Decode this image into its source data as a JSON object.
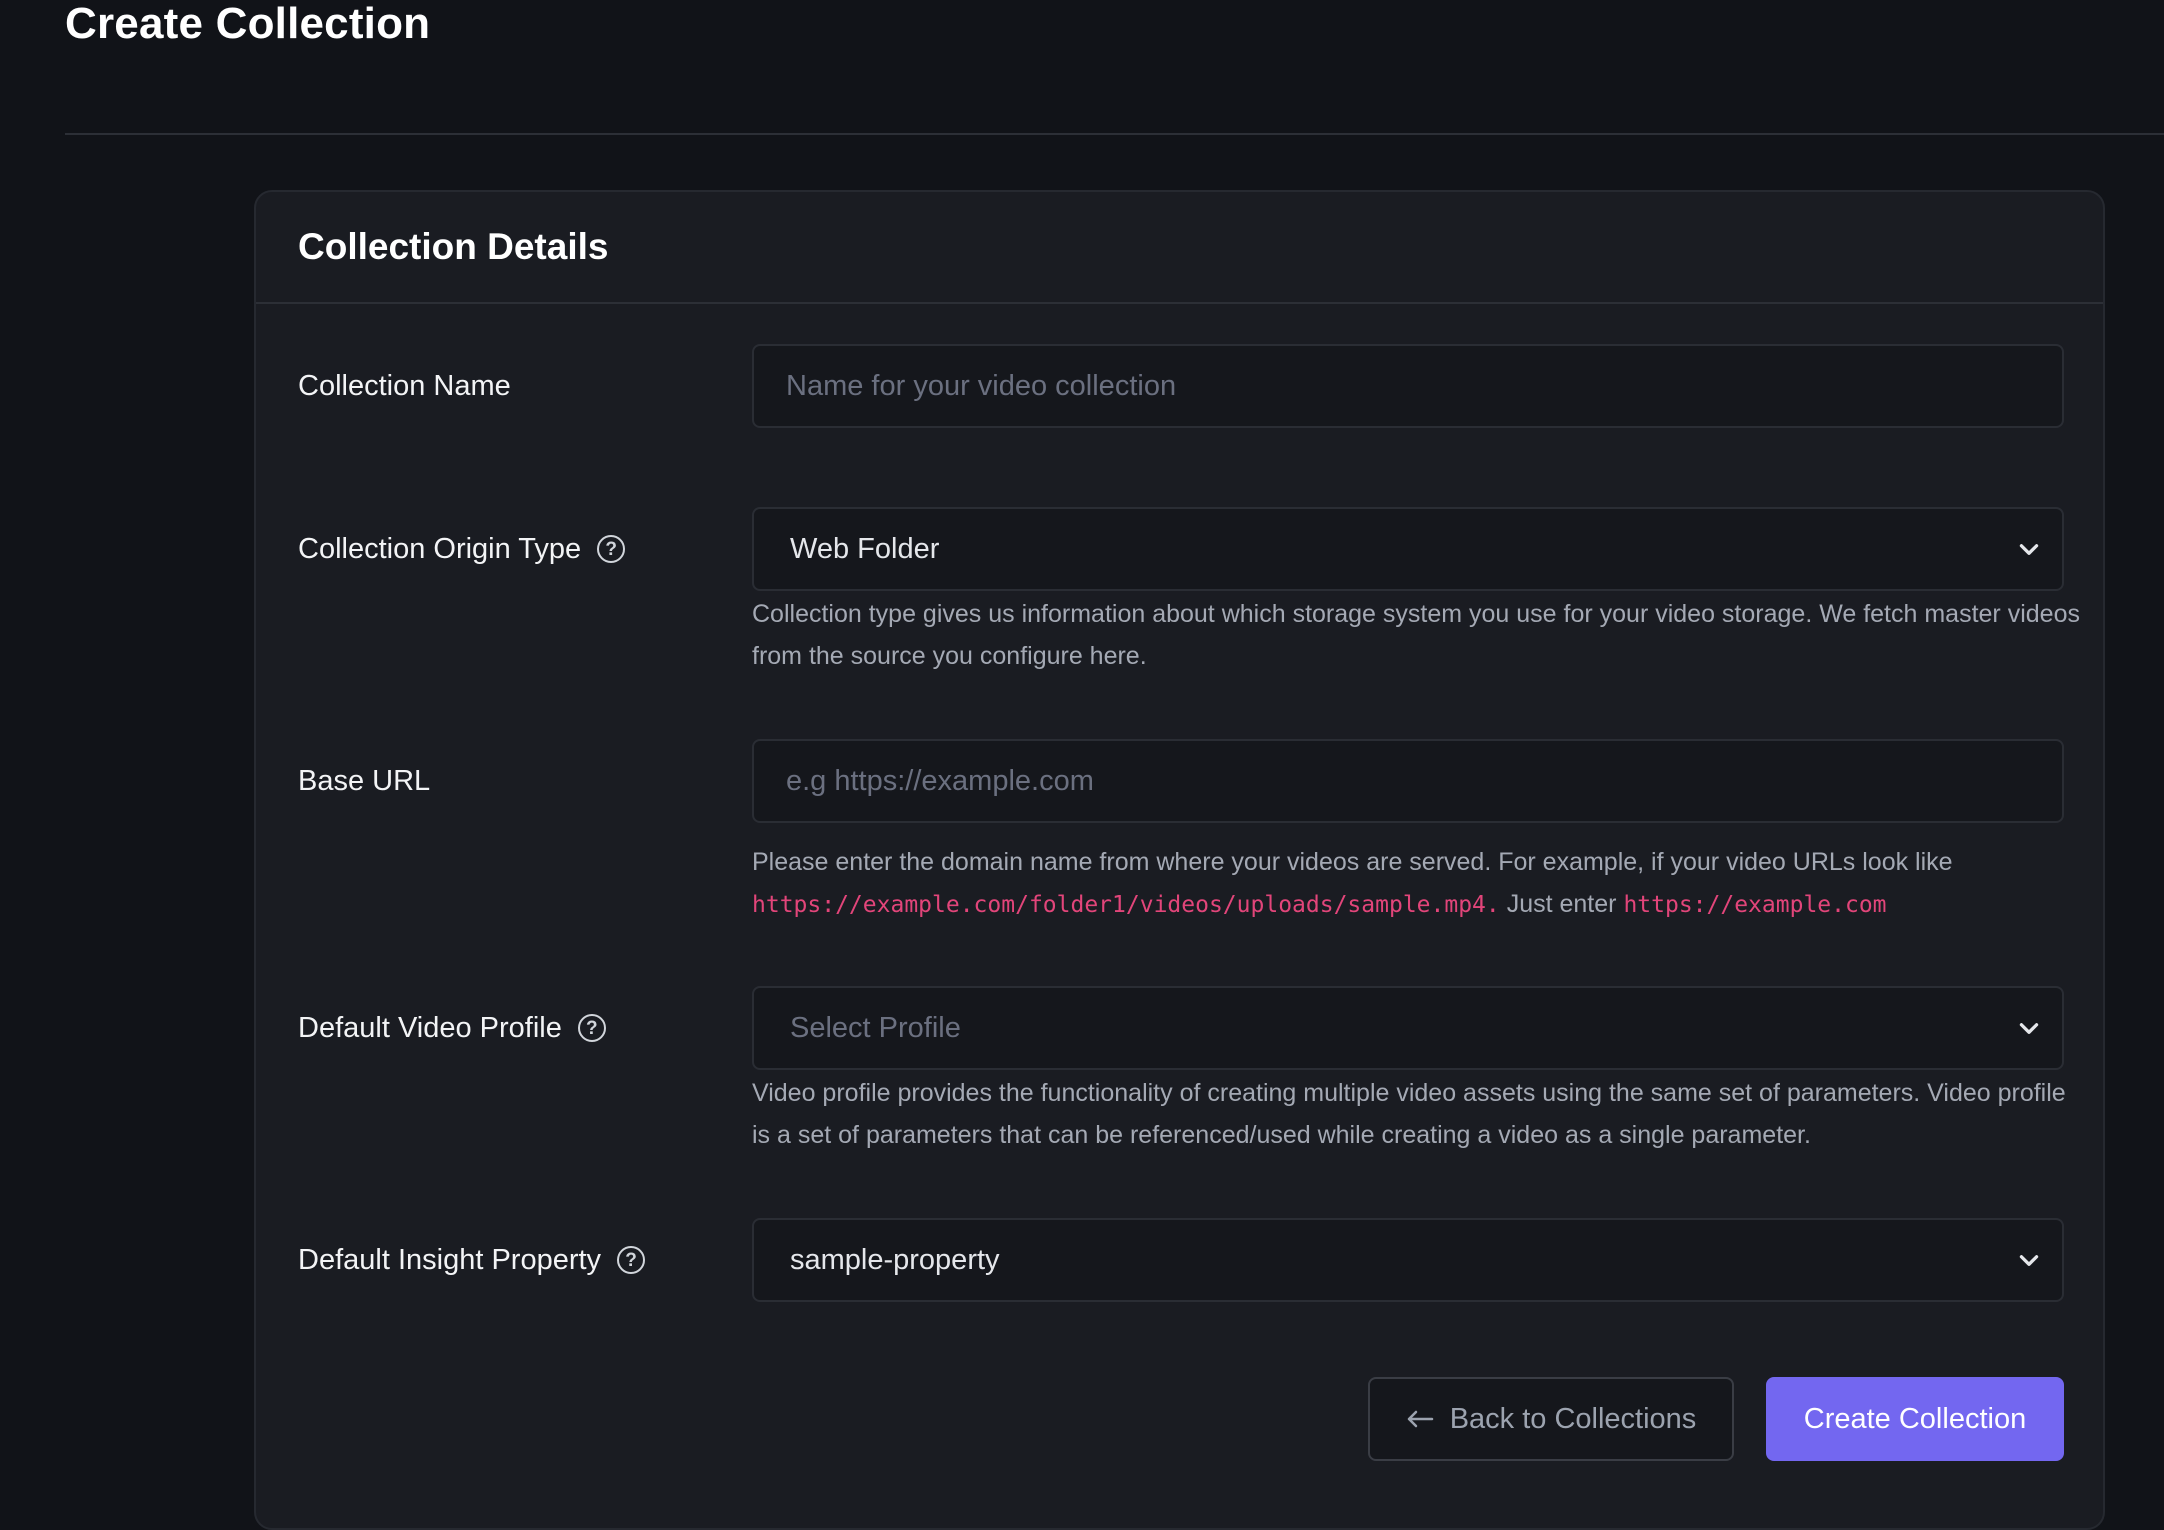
{
  "page": {
    "title": "Create Collection"
  },
  "card": {
    "title": "Collection Details"
  },
  "form": {
    "collection_name": {
      "label": "Collection Name",
      "placeholder": "Name for your video collection",
      "value": ""
    },
    "origin_type": {
      "label": "Collection Origin Type",
      "selected": "Web Folder",
      "help": "Collection type gives us information about which storage system you use for your video storage. We fetch master videos from the source you configure here."
    },
    "base_url": {
      "label": "Base URL",
      "placeholder": "e.g https://example.com",
      "value": "",
      "help_prefix": "Please enter the domain name from where your videos are served. For example, if your video URLs look like",
      "help_example_url": "https://example.com/folder1/videos/uploads/sample.mp4.",
      "help_middle": "Just enter",
      "help_base_url": "https://example.com"
    },
    "video_profile": {
      "label": "Default Video Profile",
      "placeholder": "Select Profile",
      "help": "Video profile provides the functionality of creating multiple video assets using the same set of parameters. Video profile is a set of parameters that can be referenced/used while creating a video as a single parameter."
    },
    "insight_property": {
      "label": "Default Insight Property",
      "selected": "sample-property"
    }
  },
  "actions": {
    "back_label": "Back to Collections",
    "create_label": "Create Collection"
  },
  "icons": {
    "help": "question-circle-icon",
    "chevron": "chevron-down-icon",
    "back": "arrow-left-icon"
  },
  "colors": {
    "background": "#111318",
    "card": "#1a1c22",
    "primary": "#7367f0",
    "code": "#e2457a"
  }
}
